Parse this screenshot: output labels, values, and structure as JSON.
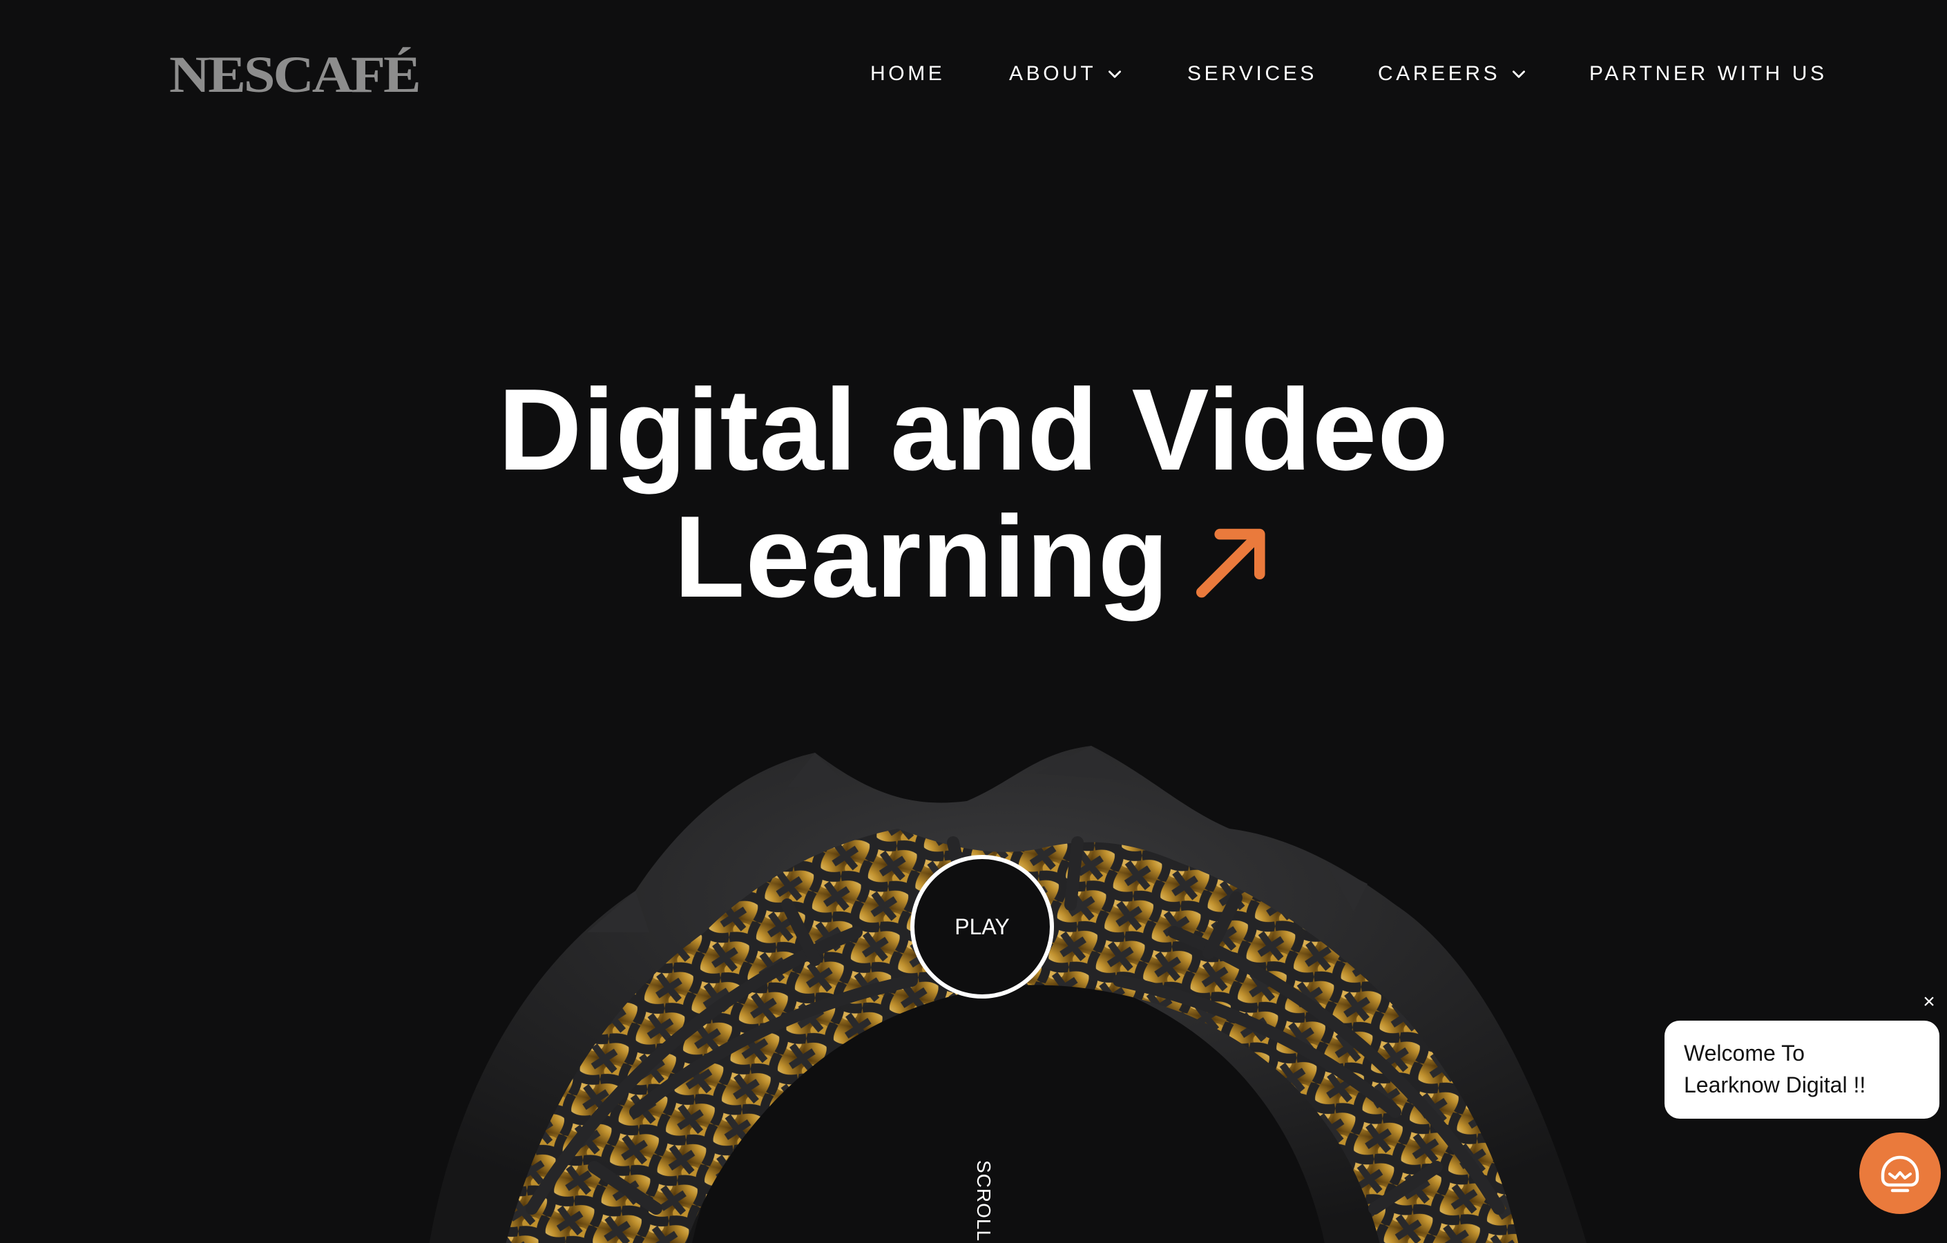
{
  "brand": {
    "logo_text": "NESCAFÉ",
    "logo_color": "#8d8d8d"
  },
  "nav": {
    "items": [
      {
        "label": "HOME",
        "has_dropdown": false
      },
      {
        "label": "ABOUT",
        "has_dropdown": true
      },
      {
        "label": "SERVICES",
        "has_dropdown": false
      },
      {
        "label": "CAREERS",
        "has_dropdown": true
      },
      {
        "label": "PARTNER WITH US",
        "has_dropdown": false
      }
    ],
    "dropdown_icon": "chevron-down-icon"
  },
  "hero": {
    "title_line1": "Digital and Video",
    "title_line2": "Learning",
    "arrow_icon": "arrow-up-right-icon",
    "accent_color": "#ea7a3c",
    "play_label": "PLAY",
    "scroll_label": "SCROLL"
  },
  "chat": {
    "close_label": "×",
    "welcome_line1": "Welcome To",
    "welcome_line2": "Learknow Digital !!",
    "launcher_icon": "chat-bot-icon",
    "launcher_color": "#ea7a3c"
  },
  "colors": {
    "background": "#0e0e0f",
    "text": "#ffffff",
    "gold": "#c8962e"
  }
}
